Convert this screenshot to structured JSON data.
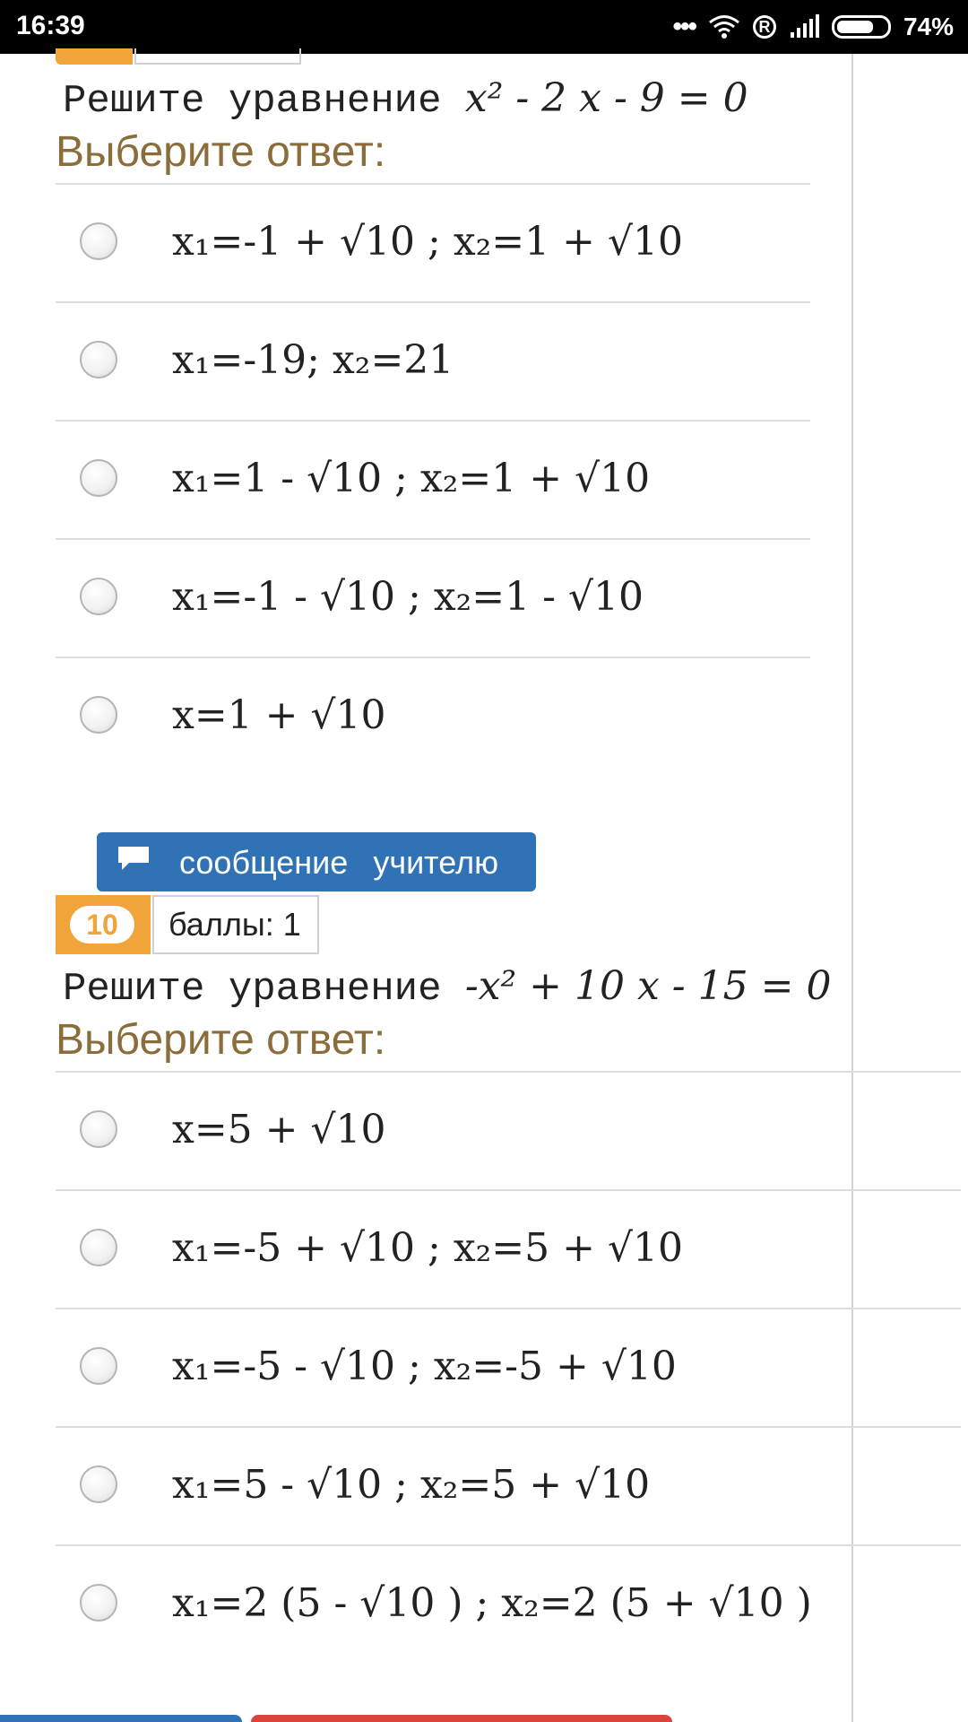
{
  "status_bar": {
    "time": "16:39",
    "dots": "•••",
    "registered": "R",
    "battery_percent": "74%",
    "battery_level": 0.74
  },
  "question1": {
    "text": "Решите уравнение",
    "math": "x² - 2 x - 9 = 0",
    "choose_label": "Выберите ответ:",
    "answers": [
      "x₁=-1 + √10 ;  x₂=1 + √10",
      "x₁=-19;  x₂=21",
      "x₁=1 - √10 ;  x₂=1 + √10",
      "x₁=-1 - √10 ;  x₂=1 - √10",
      "x=1 + √10"
    ]
  },
  "message_button": {
    "label": "сообщение учителю",
    "icon": "speech-bubble-icon"
  },
  "question2": {
    "number": "10",
    "points_label": "баллы: 1",
    "text": "Решите уравнение",
    "math": "-x² + 10 x - 15 = 0",
    "choose_label": "Выберите ответ:",
    "answers": [
      "x=5 + √10",
      "x₁=-5 + √10 ;  x₂=5 + √10",
      "x₁=-5 - √10 ;  x₂=-5 + √10",
      "x₁=5 - √10 ;  x₂=5 + √10",
      "x₁=2 (5 - √10 ) ;  x₂=2 (5 + √10 )"
    ]
  },
  "colors": {
    "accent_orange": "#f0a43a",
    "button_blue": "#2f73b6",
    "label_brown": "#8a6d3b",
    "danger_red": "#d9443c"
  }
}
